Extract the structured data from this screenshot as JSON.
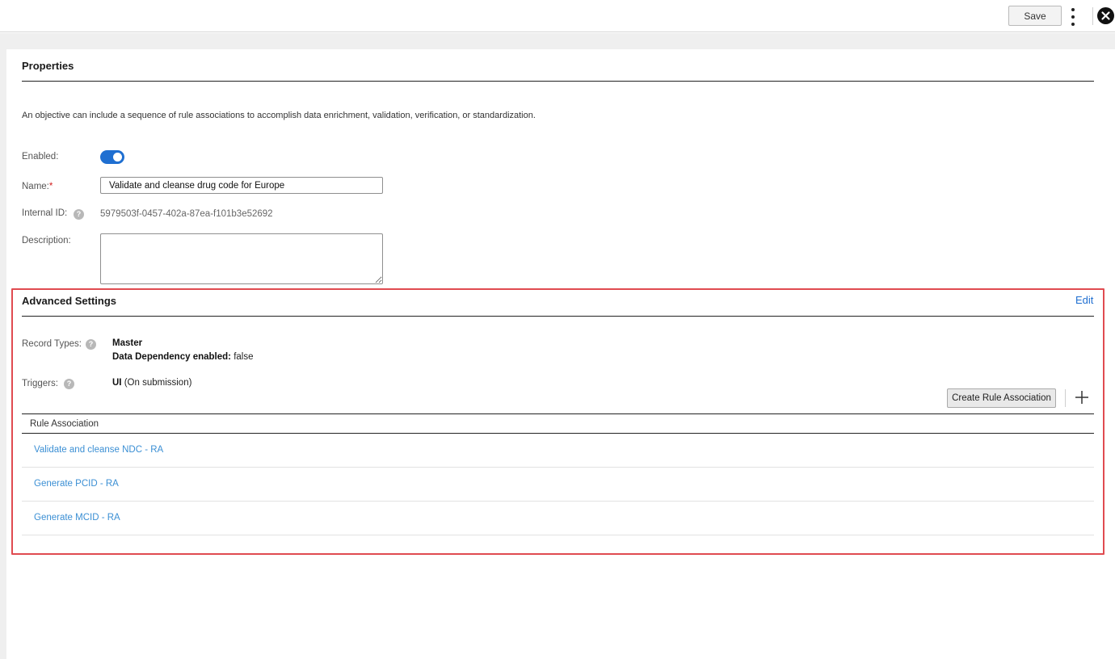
{
  "toolbar": {
    "save_label": "Save",
    "more_icon": "kebab-menu-icon",
    "close_icon": "close-circle-icon"
  },
  "properties": {
    "title": "Properties",
    "description": "An objective can include a sequence of rule associations to accomplish data enrichment, validation, verification, or standardization.",
    "enabled_label": "Enabled:",
    "enabled": true,
    "name_label": "Name:",
    "name_required_mark": "*",
    "name_value": "Validate and cleanse drug code for Europe",
    "internal_id_label": "Internal ID:",
    "internal_id_value": "5979503f-0457-402a-87ea-f101b3e52692",
    "description_label": "Description:",
    "description_value": ""
  },
  "advanced": {
    "title": "Advanced Settings",
    "edit_label": "Edit",
    "record_types_label": "Record Types:",
    "record_types_value": "Master",
    "data_dependency_label": "Data Dependency enabled:",
    "data_dependency_value": "false",
    "triggers_label": "Triggers:",
    "triggers_strong": "UI",
    "triggers_detail": "(On submission)",
    "create_rule_label": "Create Rule Association",
    "table_header": "Rule Association",
    "rule_associations": [
      "Validate and cleanse NDC - RA",
      "Generate PCID - RA",
      "Generate MCID - RA"
    ]
  },
  "colors": {
    "accent": "#1f6fd1",
    "link": "#3b8fd4",
    "highlight_border": "#e04b50"
  }
}
